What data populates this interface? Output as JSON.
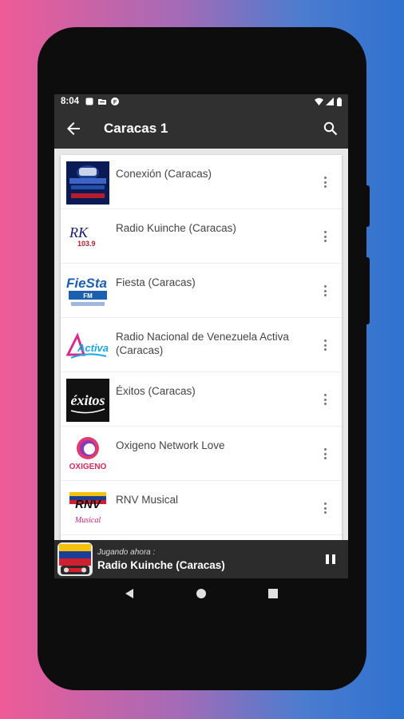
{
  "status_bar": {
    "time": "8:04"
  },
  "app_bar": {
    "title": "Caracas 1"
  },
  "stations": [
    {
      "name": "Conexión (Caracas)"
    },
    {
      "name": "Radio Kuinche (Caracas)"
    },
    {
      "name": "Fiesta (Caracas)"
    },
    {
      "name": "Radio Nacional de Venezuela Activa (Caracas)"
    },
    {
      "name": "Éxitos (Caracas)"
    },
    {
      "name": "Oxigeno Network Love"
    },
    {
      "name": "RNV Musical"
    }
  ],
  "logos": {
    "kuinche_text": "RK",
    "kuinche_freq": "103.9",
    "fiesta_text": "FieSta",
    "fiesta_sub": "FM",
    "activa_text": "Activa",
    "exitos_text": "éxitos",
    "oxigeno_text": "OXIGENO",
    "rnv_text": "RNV",
    "rnv_sub": "Musical"
  },
  "player": {
    "label": "Jugando ahora :",
    "station": "Radio Kuinche (Caracas)"
  },
  "colors": {
    "app_bar": "#303030",
    "player_bar": "#2c2c2c",
    "background_left": "#ef5b97",
    "background_right": "#2f72cf"
  }
}
